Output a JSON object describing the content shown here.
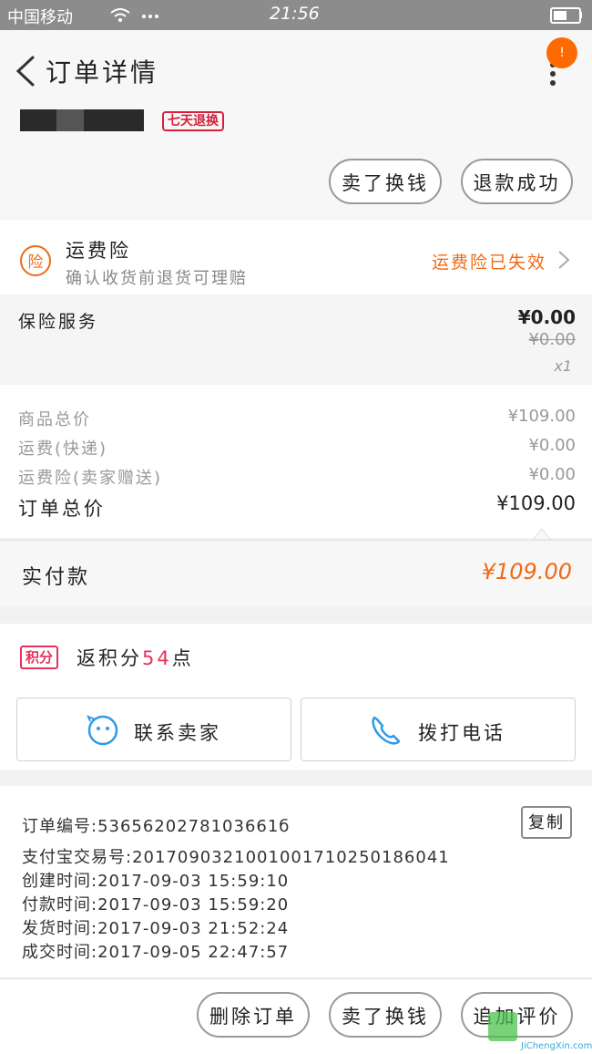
{
  "status_bar": {
    "carrier": "中国移动",
    "time": "21:56"
  },
  "header": {
    "title": "订单详情",
    "badge_count": "!"
  },
  "product": {
    "return_badge": "七天退换",
    "buttons": [
      "卖了换钱",
      "退款成功"
    ]
  },
  "insurance": {
    "icon_text": "险",
    "title": "运费险",
    "subtitle": "确认收货前退货可理赔",
    "status": "运费险已失效"
  },
  "service": {
    "label": "保险服务",
    "price": "¥0.00",
    "original_price": "¥0.00",
    "quantity": "x1"
  },
  "prices": {
    "rows": [
      {
        "label": "商品总价",
        "value": "¥109.00"
      },
      {
        "label": "运费(快递)",
        "value": "¥0.00"
      },
      {
        "label": "运费险(卖家赠送)",
        "value": "¥0.00"
      }
    ],
    "total_label": "订单总价",
    "total_value": "¥109.00"
  },
  "paid": {
    "label": "实付款",
    "value": "¥109.00"
  },
  "points": {
    "tag": "积分",
    "text_prefix": "返积分",
    "value": "54",
    "text_suffix": "点"
  },
  "contact": {
    "seller_label": "联系卖家",
    "call_label": "拨打电话"
  },
  "order_info": {
    "rows": [
      "订单编号:5365620278103661б",
      "支付宝交易号:2017090321001001710250186041",
      "创建时间:2017-09-03 15:59:10",
      "付款时间:2017-09-03 15:59:20",
      "发货时间:2017-09-03 21:52:24",
      "成交时间:2017-09-05 22:47:57"
    ],
    "copy_label": "复制"
  },
  "footer": {
    "buttons": [
      "删除订单",
      "卖了换钱",
      "追加评价"
    ],
    "watermark": "JiChengXin.com"
  },
  "colors": {
    "accent_orange": "#f06a16",
    "points_pink": "#e8325a",
    "status_bar": "#8c8c8c"
  }
}
